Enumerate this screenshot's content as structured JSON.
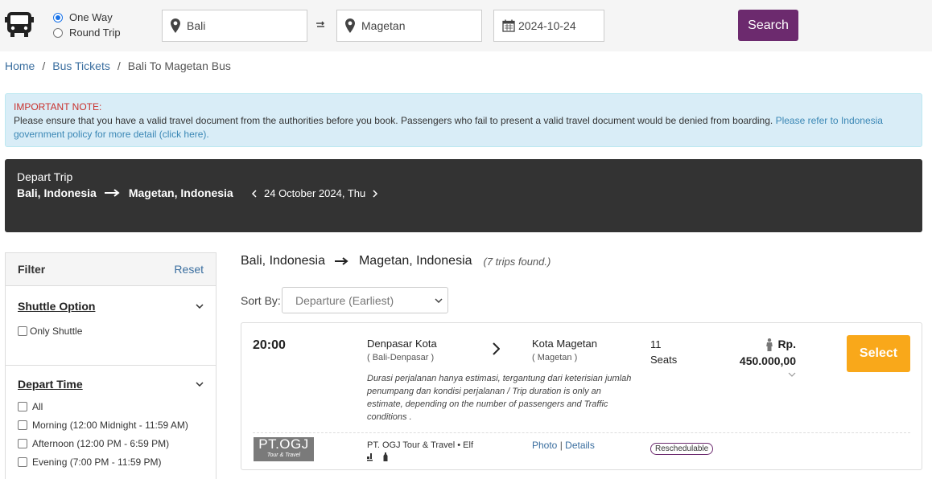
{
  "search": {
    "trip_types": [
      {
        "label": "One Way",
        "checked": true
      },
      {
        "label": "Round Trip",
        "checked": false
      }
    ],
    "from": "Bali",
    "to": "Magetan",
    "date": "2024-10-24",
    "search_label": "Search"
  },
  "breadcrumb": {
    "home": "Home",
    "bus_tickets": "Bus Tickets",
    "current": "Bali To Magetan Bus"
  },
  "note": {
    "title": "IMPORTANT NOTE:",
    "text": "Please ensure that you have a valid travel document from the authorities before you book. Passengers who fail to present a valid travel document would be denied from boarding. ",
    "link": "Please refer to Indonesia government policy for more detail (click here)."
  },
  "depart": {
    "label": "Depart Trip",
    "from": "Bali, Indonesia",
    "to": "Magetan, Indonesia",
    "date": "24 October 2024, Thu"
  },
  "filter": {
    "title": "Filter",
    "reset": "Reset",
    "shuttle_title": "Shuttle Option",
    "shuttle_option": "Only Shuttle",
    "depart_time_title": "Depart Time",
    "depart_times": [
      "All",
      "Morning (12:00 Midnight - 11:59 AM)",
      "Afternoon (12:00 PM - 6:59 PM)",
      "Evening (7:00 PM - 11:59 PM)"
    ]
  },
  "results": {
    "from": "Bali, Indonesia",
    "to": "Magetan, Indonesia",
    "count": "(7 trips found.)",
    "sort_label": "Sort By:",
    "sort_value": "Departure (Earliest)"
  },
  "trip": {
    "time": "20:00",
    "from": "Denpasar Kota",
    "from_sub": "( Bali-Denpasar )",
    "to": "Kota Magetan",
    "to_sub": "( Magetan )",
    "seats_count": "11",
    "seats_label": "Seats",
    "currency": "Rp.",
    "price": "450.000,00",
    "select_label": "Select",
    "description": "Durasi perjalanan hanya estimasi, tergantung dari keterisian jumlah penumpang dan kondisi perjalanan / Trip duration is only an estimate, depending on the number of passengers and Traffic conditions .",
    "logo_line1": "PT.OGJ",
    "logo_line2": "Tour & Travel",
    "operator": "PT. OGJ Tour & Travel • Elf",
    "photo_link": "Photo",
    "details_link": "Details",
    "badge": "Reschedulable"
  }
}
